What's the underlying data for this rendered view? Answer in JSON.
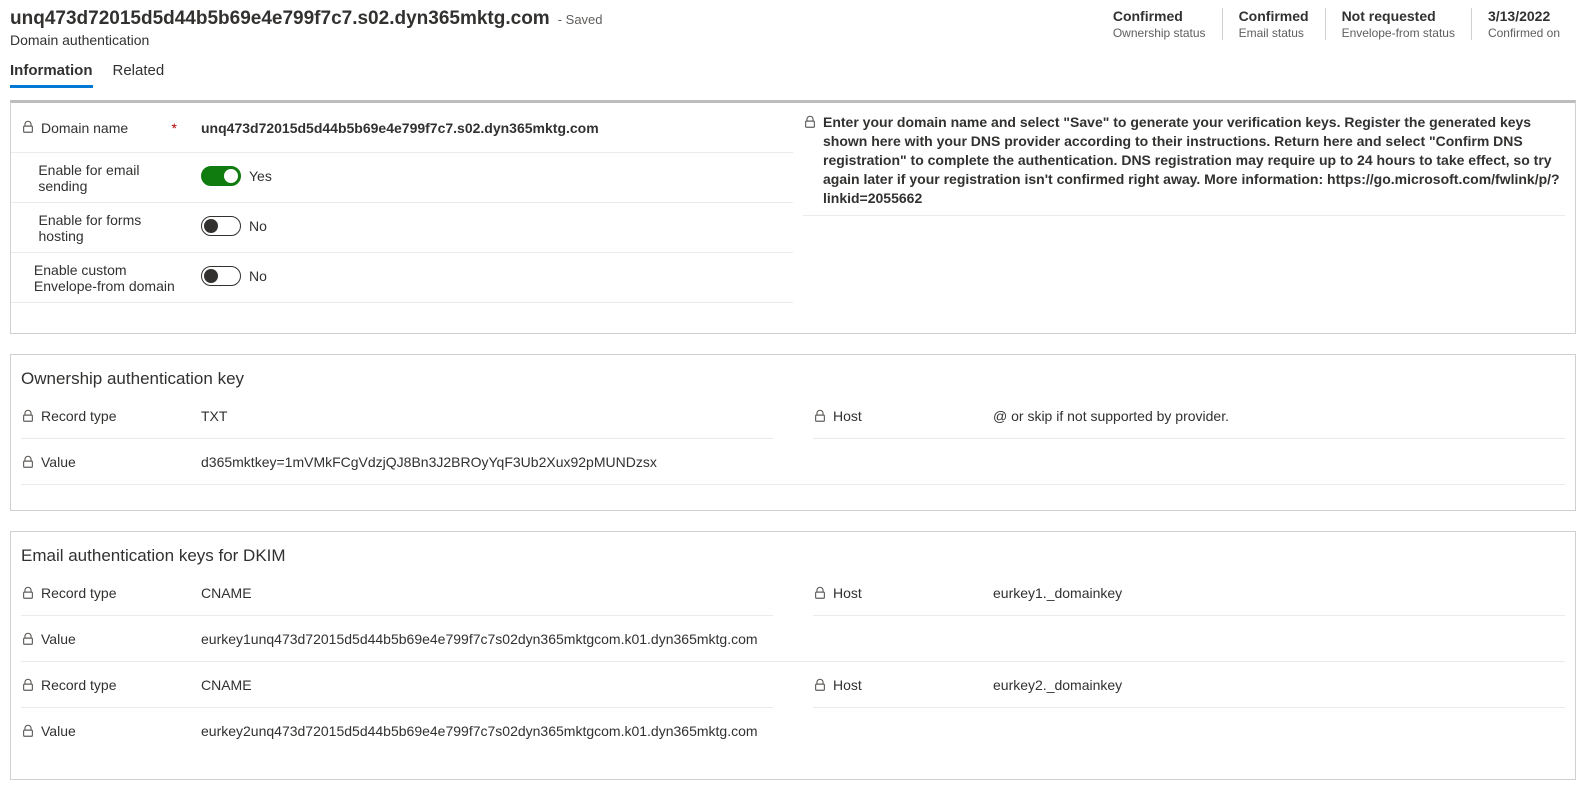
{
  "header": {
    "title": "unq473d72015d5d44b5b69e4e799f7c7.s02.dyn365mktg.com",
    "saved": "- Saved",
    "subtitle": "Domain authentication",
    "status": [
      {
        "value": "Confirmed",
        "label": "Ownership status"
      },
      {
        "value": "Confirmed",
        "label": "Email status"
      },
      {
        "value": "Not requested",
        "label": "Envelope-from status"
      },
      {
        "value": "3/13/2022",
        "label": "Confirmed on"
      }
    ]
  },
  "tabs": {
    "information": "Information",
    "related": "Related"
  },
  "form": {
    "domain_name_label": "Domain name",
    "domain_name_value": "unq473d72015d5d44b5b69e4e799f7c7.s02.dyn365mktg.com",
    "enable_email_label": "Enable for email sending",
    "enable_email_value": "Yes",
    "enable_forms_label": "Enable for forms hosting",
    "enable_forms_value": "No",
    "enable_envelope_label": "Enable custom Envelope-from domain",
    "enable_envelope_value": "No",
    "help_text": "Enter your domain name and select \"Save\" to generate your verification keys. Register the generated keys shown here with your DNS provider according to their instructions. Return here and select \"Confirm DNS registration\" to complete the authentication. DNS registration may require up to 24 hours to take effect, so try again later if your registration isn't confirmed right away. More information: https://go.microsoft.com/fwlink/p/?linkid=2055662"
  },
  "ownership": {
    "title": "Ownership authentication key",
    "record_type_label": "Record type",
    "record_type_value": "TXT",
    "host_label": "Host",
    "host_value": "@ or skip if not supported by provider.",
    "value_label": "Value",
    "value_value": "d365mktkey=1mVMkFCgVdzjQJ8Bn3J2BROyYqF3Ub2Xux92pMUNDzsx"
  },
  "dkim": {
    "title": "Email authentication keys for DKIM",
    "record_type_label": "Record type",
    "host_label": "Host",
    "value_label": "Value",
    "rec1_type": "CNAME",
    "rec1_host": "eurkey1._domainkey",
    "rec1_value": "eurkey1unq473d72015d5d44b5b69e4e799f7c7s02dyn365mktgcom.k01.dyn365mktg.com",
    "rec2_type": "CNAME",
    "rec2_host": "eurkey2._domainkey",
    "rec2_value": "eurkey2unq473d72015d5d44b5b69e4e799f7c7s02dyn365mktgcom.k01.dyn365mktg.com"
  }
}
